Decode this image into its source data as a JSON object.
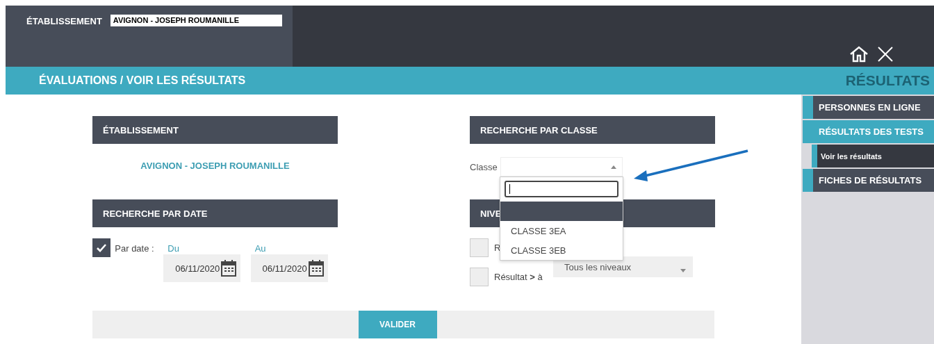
{
  "header": {
    "establishment_label": "ÉTABLISSEMENT",
    "establishment_value": "AVIGNON - JOSEPH ROUMANILLE"
  },
  "title_bar": {
    "title": "ÉVALUATIONS / VOIR LES RÉSULTATS",
    "section": "RÉSULTATS"
  },
  "sidebar": {
    "items": [
      {
        "label": "PERSONNES EN LIGNE",
        "selected": false
      },
      {
        "label": "RÉSULTATS DES TESTS",
        "selected": true,
        "children": [
          {
            "label": "Voir les résultats",
            "selected": true
          }
        ]
      },
      {
        "label": "FICHES DE RÉSULTATS",
        "selected": false
      }
    ]
  },
  "establishment_panel": {
    "title": "ÉTABLISSEMENT",
    "value": "AVIGNON - JOSEPH ROUMANILLE"
  },
  "date_panel": {
    "title": "RECHERCHE PAR DATE",
    "checked": true,
    "label": "Par date :",
    "from_label": "Du",
    "from_value": "06/11/2020",
    "to_label": "Au",
    "to_value": "06/11/2020"
  },
  "class_panel": {
    "title": "RECHERCHE PAR CLASSE",
    "label": "Classe",
    "expanded": true,
    "options": [
      {
        "selected": true
      },
      {
        "label": "CLASSE 3EA",
        "selected": false
      },
      {
        "label": "CLASSE 3EB",
        "selected": false
      }
    ]
  },
  "level_panel": {
    "title": "NIVE",
    "checks": [
      {
        "label": "R",
        "checked": false
      },
      {
        "label": "Résultat **>** à",
        "checked": false
      }
    ],
    "select_value": "Tous les niveaux"
  },
  "submit": "VALIDER"
}
